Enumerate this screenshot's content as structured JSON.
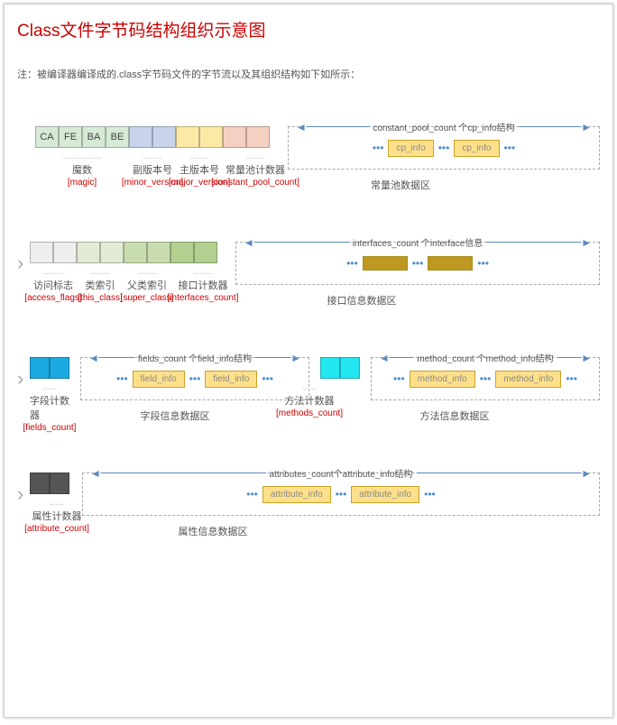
{
  "title": "Class文件字节码结构组织示意图",
  "note": "注：被编译器编译成的.class字节码文件的字节流以及其组织结构如下如所示：",
  "row1": {
    "magic_cells": [
      "CA",
      "FE",
      "BA",
      "BE"
    ],
    "labels": [
      {
        "name": "魔数",
        "key": "[magic]"
      },
      {
        "name": "副版本号",
        "key": "[minor_version]"
      },
      {
        "name": "主版本号",
        "key": "[major_version]"
      },
      {
        "name": "常量池计数器",
        "key": "[constant_pool_count]"
      }
    ],
    "area_title": "constant_pool_count 个cp_info结构",
    "info": "cp_info",
    "area_name": "常量池数据区"
  },
  "row2": {
    "labels": [
      {
        "name": "访问标志",
        "key": "[access_flags]"
      },
      {
        "name": "类索引",
        "key": "[this_class]"
      },
      {
        "name": "父类索引",
        "key": "[super_class]"
      },
      {
        "name": "接口计数器",
        "key": "[interfaces_count]"
      }
    ],
    "area_title": "interfaces_count 个interface信息",
    "area_name": "接口信息数据区"
  },
  "row3": {
    "fields": {
      "name": "字段计数器",
      "key": "[fields_count]"
    },
    "fields_area": {
      "title": "fields_count 个field_info结构",
      "info": "field_info",
      "name": "字段信息数据区"
    },
    "methods": {
      "name": "方法计数器",
      "key": "[methods_count]"
    },
    "methods_area": {
      "title": "method_count 个method_info结构",
      "info": "method_info",
      "name": "方法信息数据区"
    }
  },
  "row4": {
    "attr": {
      "name": "属性计数器",
      "key": "[attribute_count]"
    },
    "area": {
      "title": "attributes_count个attribute_info结构",
      "info": "attribute_info",
      "name": "属性信息数据区"
    }
  },
  "dots": "•••"
}
